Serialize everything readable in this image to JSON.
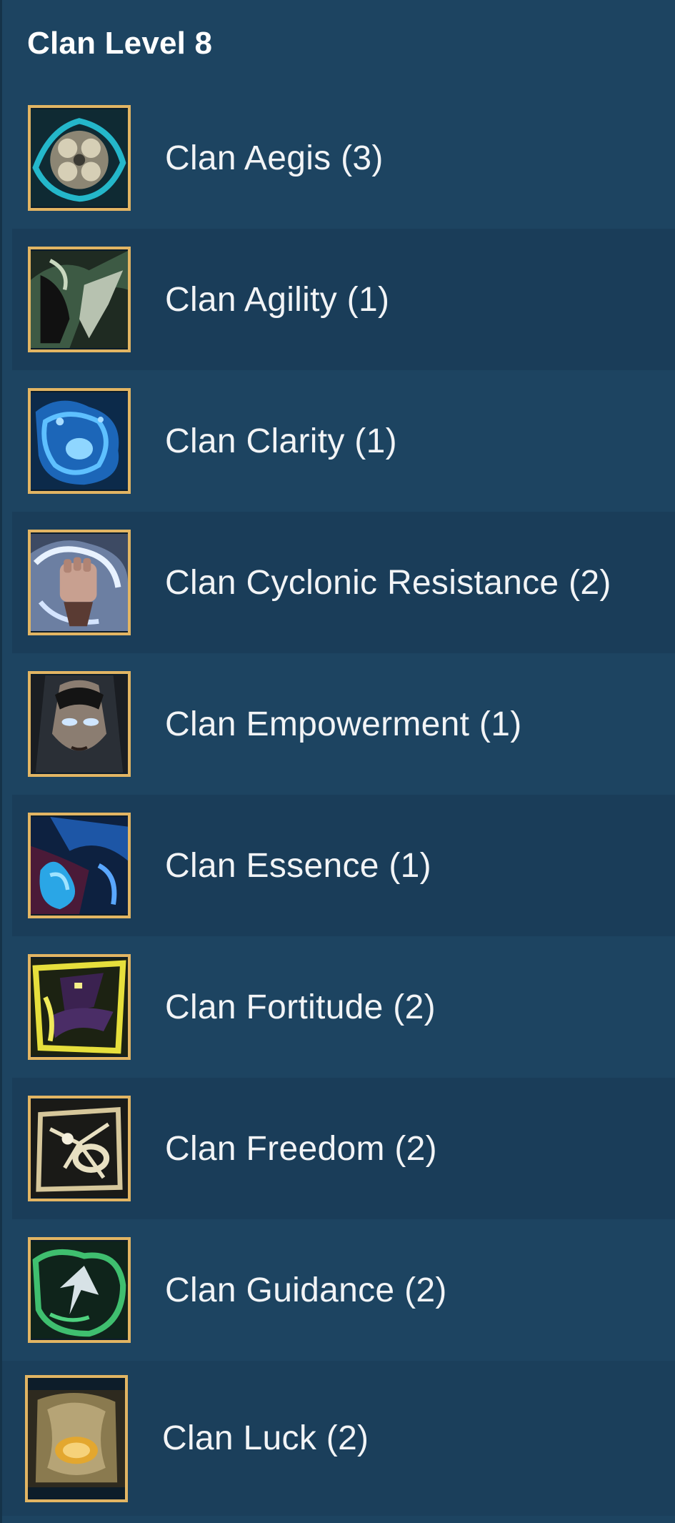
{
  "header": {
    "title": "Clan Level 8"
  },
  "items": [
    {
      "label": "Clan Aegis (3)",
      "icon": "aegis-icon",
      "color": "#26c2d6"
    },
    {
      "label": "Clan Agility (1)",
      "icon": "agility-icon",
      "color": "#8fbf7a"
    },
    {
      "label": "Clan Clarity (1)",
      "icon": "clarity-icon",
      "color": "#2f9be8"
    },
    {
      "label": "Clan Cyclonic Resistance (2)",
      "icon": "cyclonic-resistance-icon",
      "color": "#a9c6e6"
    },
    {
      "label": "Clan Empowerment (1)",
      "icon": "empowerment-icon",
      "color": "#6f8a9a"
    },
    {
      "label": "Clan Essence (1)",
      "icon": "essence-icon",
      "color": "#2a8ee0"
    },
    {
      "label": "Clan Fortitude (2)",
      "icon": "fortitude-icon",
      "color": "#d8d23a"
    },
    {
      "label": "Clan Freedom (2)",
      "icon": "freedom-icon",
      "color": "#d9c9a0"
    },
    {
      "label": "Clan Guidance (2)",
      "icon": "guidance-icon",
      "color": "#3fb86b"
    },
    {
      "label": "Clan Luck (2)",
      "icon": "luck-icon",
      "color": "#e7b54a"
    }
  ]
}
